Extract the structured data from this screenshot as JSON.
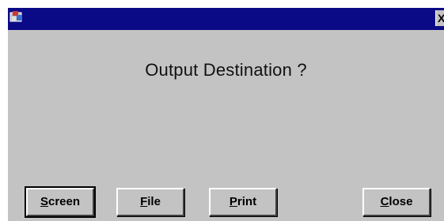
{
  "dialog": {
    "heading": "Output Destination ?",
    "close_glyph": "X",
    "icons": {
      "app": "app-icon",
      "close": "close-icon"
    },
    "colors": {
      "titlebar": "#0b0a86",
      "face": "#c3c3c3"
    }
  },
  "buttons": {
    "screen": {
      "mnemonic": "S",
      "rest": "creen"
    },
    "file": {
      "mnemonic": "F",
      "rest": "ile"
    },
    "print": {
      "mnemonic": "P",
      "rest": "rint"
    },
    "close": {
      "mnemonic": "C",
      "rest": "lose"
    }
  }
}
